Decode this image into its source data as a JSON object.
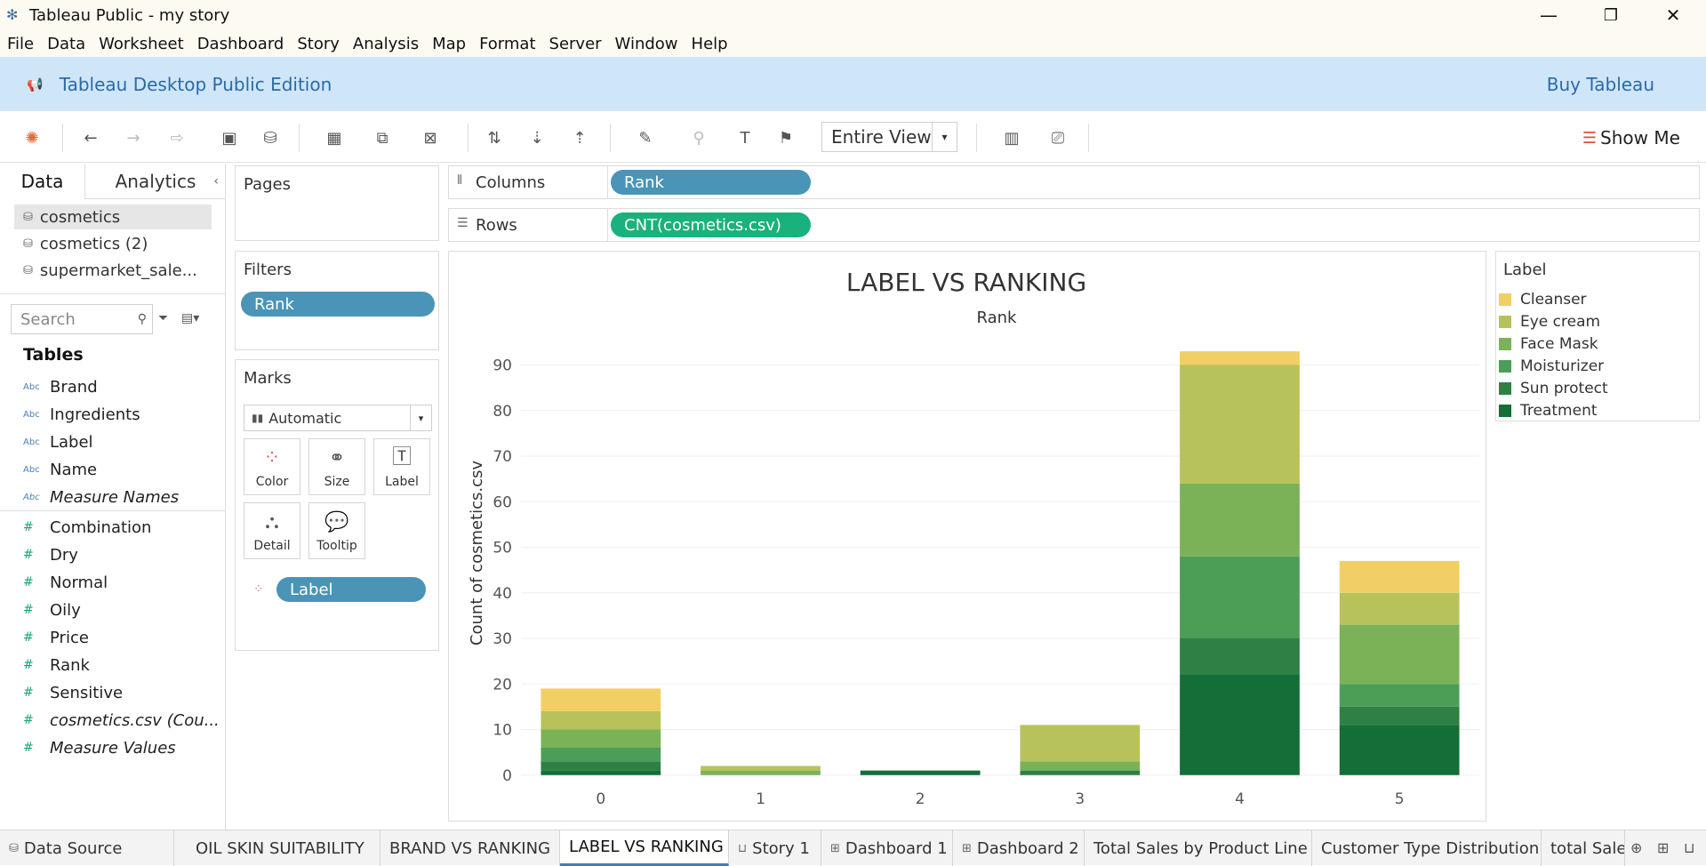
{
  "window": {
    "title": "Tableau Public - my story",
    "minimize": "—",
    "restore": "❐",
    "close": "✕"
  },
  "menu": [
    "File",
    "Data",
    "Worksheet",
    "Dashboard",
    "Story",
    "Analysis",
    "Map",
    "Format",
    "Server",
    "Window",
    "Help"
  ],
  "banner": {
    "edition": "Tableau Desktop Public Edition",
    "buy": "Buy Tableau"
  },
  "toolbar": {
    "fit": "Entire View",
    "show_me": "Show Me"
  },
  "left_panel": {
    "tab_data": "Data",
    "tab_analytics": "Analytics",
    "data_sources": [
      "cosmetics",
      "cosmetics (2)",
      "supermarket_sale..."
    ],
    "search_placeholder": "Search",
    "tables_header": "Tables",
    "dimension_fields": [
      "Brand",
      "Ingredients",
      "Label",
      "Name",
      "Measure Names"
    ],
    "measure_fields": [
      "Combination",
      "Dry",
      "Normal",
      "Oily",
      "Price",
      "Rank",
      "Sensitive",
      "cosmetics.csv (Cou...",
      "Measure Values"
    ],
    "abc": "Abc",
    "hash": "#"
  },
  "shelves": {
    "pages": "Pages",
    "filters": "Filters",
    "filter_pill": "Rank",
    "marks": "Marks",
    "mark_type": "Automatic",
    "mark_buttons": [
      "Color",
      "Size",
      "Label",
      "Detail",
      "Tooltip"
    ],
    "label_pill": "Label",
    "columns": "Columns",
    "columns_pill": "Rank",
    "rows": "Rows",
    "rows_pill": "CNT(cosmetics.csv)"
  },
  "colors": {
    "Cleanser": "#f2cf64",
    "Eye cream": "#b7c35a",
    "Face Mask": "#7bb257",
    "Moisturizer": "#4c9e56",
    "Sun protect": "#2f8045",
    "Treatment": "#146e38"
  },
  "chart_data": {
    "type": "bar",
    "stacked": true,
    "title": "LABEL VS RANKING",
    "top_label": "Rank",
    "ylabel": "Count of cosmetics.csv",
    "ylim": [
      -2,
      94
    ],
    "yticks": [
      0,
      10,
      20,
      30,
      40,
      50,
      60,
      70,
      80,
      90
    ],
    "categories": [
      "0",
      "1",
      "2",
      "3",
      "4",
      "5"
    ],
    "series": [
      {
        "name": "Treatment",
        "values": [
          1,
          0,
          1,
          0,
          22,
          11
        ]
      },
      {
        "name": "Sun protect",
        "values": [
          2,
          0,
          0,
          1,
          8,
          4
        ]
      },
      {
        "name": "Moisturizer",
        "values": [
          3,
          0,
          0,
          0,
          18,
          5
        ]
      },
      {
        "name": "Face Mask",
        "values": [
          4,
          1,
          0,
          2,
          16,
          13
        ]
      },
      {
        "name": "Eye cream",
        "values": [
          4,
          1,
          0,
          8,
          26,
          7
        ]
      },
      {
        "name": "Cleanser",
        "values": [
          5,
          0,
          0,
          0,
          3,
          7
        ]
      }
    ],
    "legend_title": "Label",
    "legend": [
      "Cleanser",
      "Eye cream",
      "Face Mask",
      "Moisturizer",
      "Sun protect",
      "Treatment"
    ],
    "grid": true,
    "legend_position": "right"
  },
  "sheet_tabs": [
    "Data Source",
    "OIL SKIN SUITABILITY",
    "BRAND VS RANKING",
    "LABEL VS RANKING",
    "Story 1",
    "Dashboard 1",
    "Dashboard 2",
    "Total Sales by Product Line",
    "Customer Type Distribution",
    "total Sales"
  ],
  "active_tab": "LABEL VS RANKING"
}
